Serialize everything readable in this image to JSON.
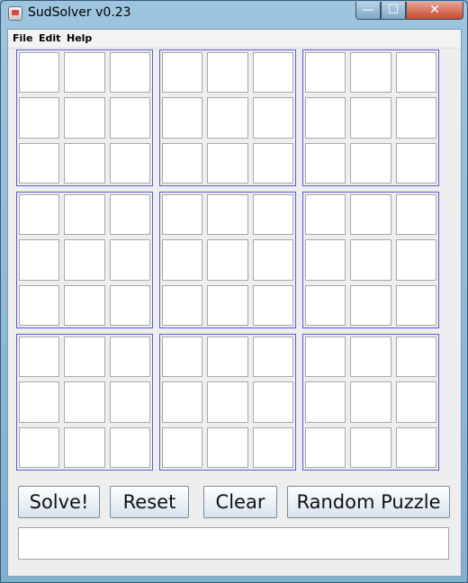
{
  "window": {
    "title": "SudSolver v0.23",
    "minimize_glyph": "—",
    "maximize_glyph": "☐",
    "close_glyph": "✕"
  },
  "menu": [
    "File",
    "Edit",
    "Help"
  ],
  "grid": {
    "values": [
      [
        "",
        "",
        "",
        "",
        "",
        "",
        "",
        "",
        ""
      ],
      [
        "",
        "",
        "",
        "",
        "",
        "",
        "",
        "",
        ""
      ],
      [
        "",
        "",
        "",
        "",
        "",
        "",
        "",
        "",
        ""
      ],
      [
        "",
        "",
        "",
        "",
        "",
        "",
        "",
        "",
        ""
      ],
      [
        "",
        "",
        "",
        "",
        "",
        "",
        "",
        "",
        ""
      ],
      [
        "",
        "",
        "",
        "",
        "",
        "",
        "",
        "",
        ""
      ],
      [
        "",
        "",
        "",
        "",
        "",
        "",
        "",
        "",
        ""
      ],
      [
        "",
        "",
        "",
        "",
        "",
        "",
        "",
        "",
        ""
      ],
      [
        "",
        "",
        "",
        "",
        "",
        "",
        "",
        "",
        ""
      ]
    ]
  },
  "buttons": {
    "solve": "Solve!",
    "reset": "Reset",
    "clear": "Clear",
    "random": "Random Puzzle"
  },
  "status": {
    "text": ""
  }
}
